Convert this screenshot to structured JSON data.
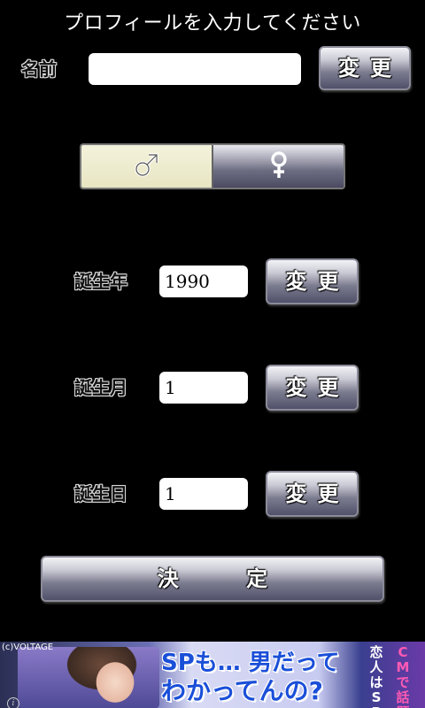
{
  "header": {
    "title": "プロフィールを入力してください"
  },
  "name_row": {
    "label": "名前",
    "value": "",
    "change_label": "変更"
  },
  "gender": {
    "male_icon": "male-symbol-icon",
    "female_icon": "female-symbol-icon",
    "selected": "male"
  },
  "birth_year": {
    "label": "誕生年",
    "value": "1990",
    "change_label": "変更"
  },
  "birth_month": {
    "label": "誕生月",
    "value": "1",
    "change_label": "変更"
  },
  "birth_day": {
    "label": "誕生日",
    "value": "1",
    "change_label": "変更"
  },
  "submit": {
    "label": "決 定"
  },
  "ad": {
    "copyright": "(c)VOLTAGE",
    "headline_1": "SPも… 男だって",
    "headline_2": "わかってんの?",
    "vert_1": "恋人はSP",
    "vert_2": "CMで話題",
    "info_glyph": "i"
  },
  "colors": {
    "background": "#000000",
    "selected_gender": "#e7e5c2",
    "button_dark": "#50506a"
  }
}
